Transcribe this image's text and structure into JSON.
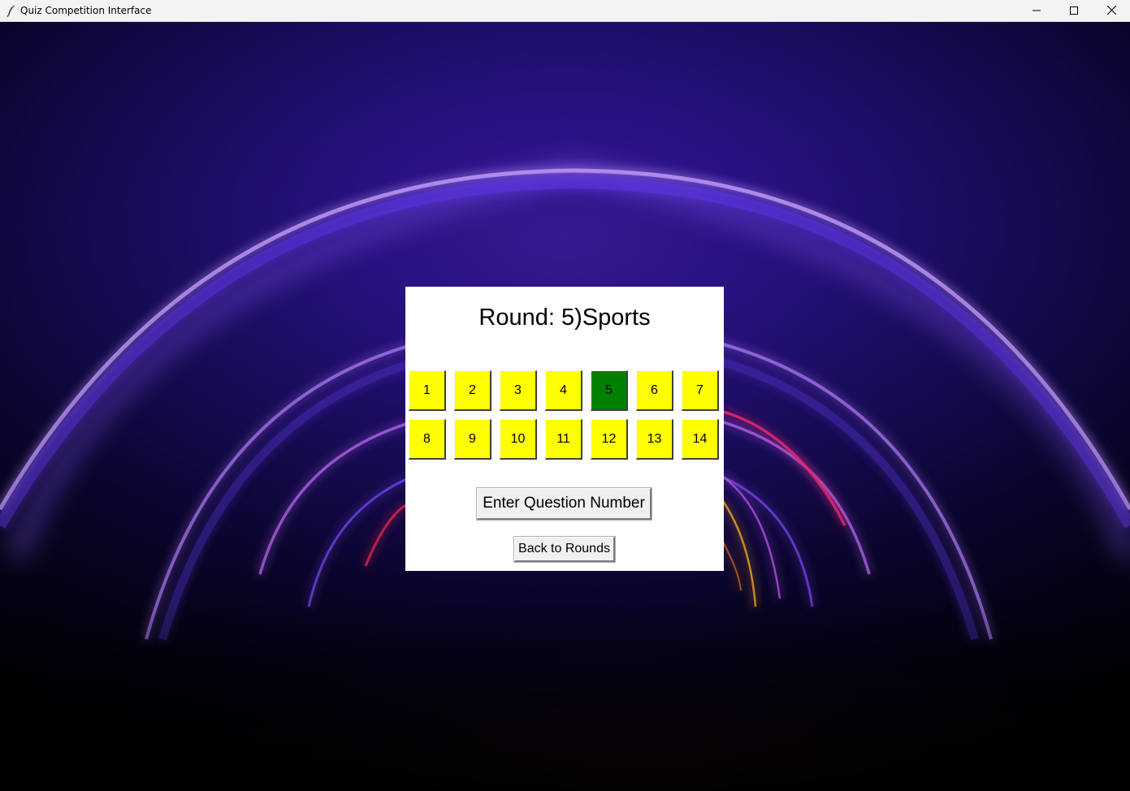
{
  "window": {
    "title": "Quiz Competition Interface",
    "app_icon": "feather-icon",
    "controls": [
      "minimize-icon",
      "maximize-icon",
      "close-icon"
    ]
  },
  "panel": {
    "round_title": "Round: 5)Sports",
    "questions": [
      {
        "label": "1",
        "state": "available"
      },
      {
        "label": "2",
        "state": "available"
      },
      {
        "label": "3",
        "state": "available"
      },
      {
        "label": "4",
        "state": "available"
      },
      {
        "label": "5",
        "state": "selected"
      },
      {
        "label": "6",
        "state": "available"
      },
      {
        "label": "7",
        "state": "available"
      },
      {
        "label": "8",
        "state": "available"
      },
      {
        "label": "9",
        "state": "available"
      },
      {
        "label": "10",
        "state": "available"
      },
      {
        "label": "11",
        "state": "available"
      },
      {
        "label": "12",
        "state": "available"
      },
      {
        "label": "13",
        "state": "available"
      },
      {
        "label": "14",
        "state": "available"
      }
    ],
    "enter_button_label": "Enter Question Number",
    "back_button_label": "Back to Rounds"
  },
  "colors": {
    "question_available": "#ffff00",
    "question_selected": "#008000",
    "panel_background": "#ffffff"
  }
}
